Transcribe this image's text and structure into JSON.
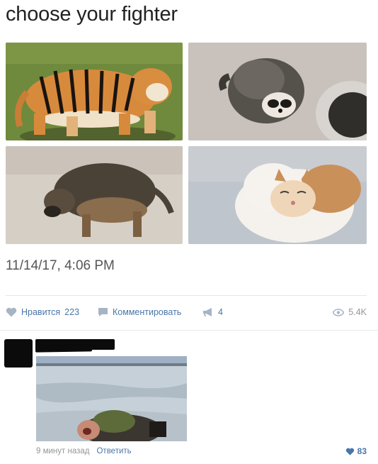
{
  "post": {
    "title": "choose your fighter",
    "timestamp": "11/14/17, 4:06 PM",
    "photos": [
      "tiger",
      "raccoon",
      "dog",
      "cat"
    ]
  },
  "actions": {
    "like_label": "Нравится",
    "like_count": "223",
    "comment_label": "Комментировать",
    "share_count": "4",
    "views": "5.4K"
  },
  "comment": {
    "time": "9 минут назад",
    "reply_label": "Ответить",
    "likes": "83"
  },
  "colors": {
    "link": "#4a76a8",
    "muted": "#939699",
    "divider": "#e7e8ec"
  },
  "icons": [
    "heart-icon",
    "comment-icon",
    "megaphone-icon",
    "eye-icon"
  ]
}
